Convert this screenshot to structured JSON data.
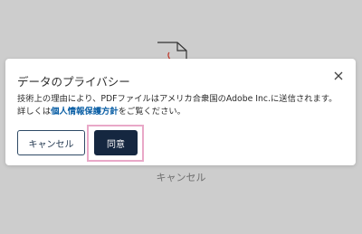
{
  "background": {
    "cancel_label": "キャンセル",
    "icon": "pdf-document-icon"
  },
  "dialog": {
    "title": "データのプライバシー",
    "close_icon": "close-icon",
    "message_before_link": "技術上の理由により、PDFファイルはアメリカ合衆国のAdobe Inc.に送信されます。詳しくは",
    "privacy_link": "個人情報保護方針",
    "message_after_link": "をご覧ください。",
    "cancel_label": "キャンセル",
    "agree_label": "同意"
  },
  "colors": {
    "overlay": "#cdcdcd",
    "primary_button": "#152740",
    "link": "#0b5fa5",
    "focus_ring": "#e9a8c8"
  }
}
